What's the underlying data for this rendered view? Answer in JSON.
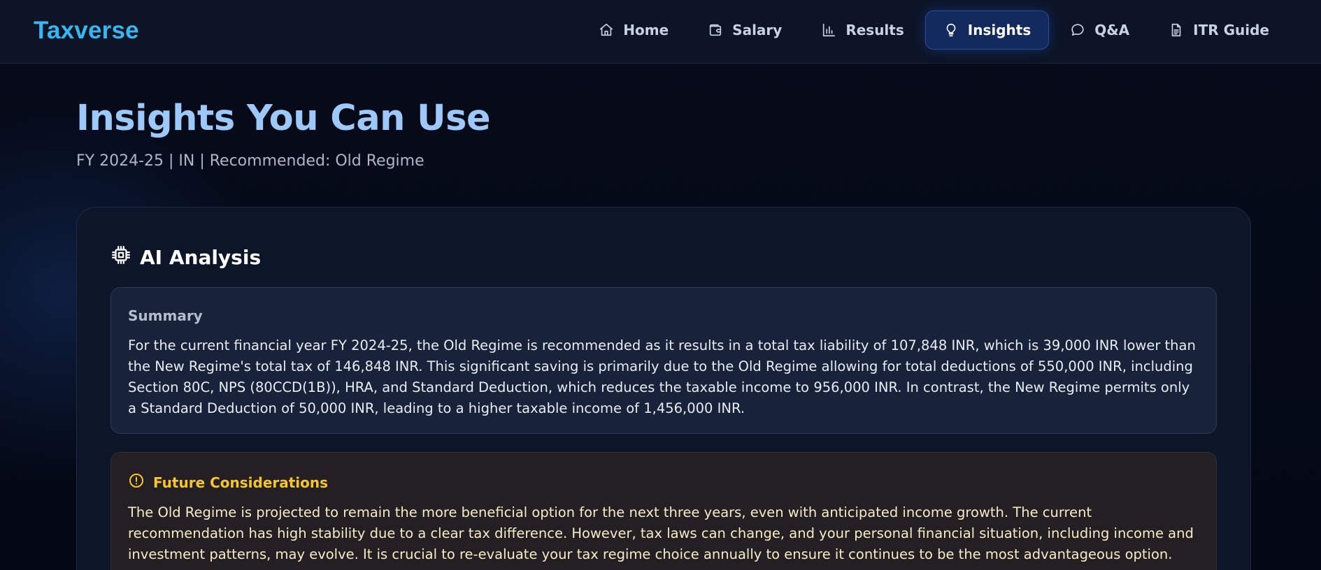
{
  "brand": "Taxverse",
  "nav": {
    "items": [
      {
        "label": "Home",
        "icon": "home-icon"
      },
      {
        "label": "Salary",
        "icon": "wallet-icon"
      },
      {
        "label": "Results",
        "icon": "bar-chart-icon"
      },
      {
        "label": "Insights",
        "icon": "lightbulb-icon",
        "active": true
      },
      {
        "label": "Q&A",
        "icon": "chat-bubble-icon"
      },
      {
        "label": "ITR Guide",
        "icon": "document-icon"
      }
    ]
  },
  "header": {
    "title": "Insights You Can Use",
    "subtitle": "FY 2024-25 | IN | Recommended: Old Regime"
  },
  "analysis": {
    "heading": "AI Analysis",
    "heading_icon": "cpu-chip-icon",
    "summary": {
      "title": "Summary",
      "text": "For the current financial year FY 2024-25, the Old Regime is recommended as it results in a total tax liability of 107,848 INR, which is 39,000 INR lower than the New Regime's total tax of 146,848 INR. This significant saving is primarily due to the Old Regime allowing for total deductions of 550,000 INR, including Section 80C, NPS (80CCD(1B)), HRA, and Standard Deduction, which reduces the taxable income to 956,000 INR. In contrast, the New Regime permits only a Standard Deduction of 50,000 INR, leading to a higher taxable income of 1,456,000 INR."
    },
    "future": {
      "title": "Future Considerations",
      "icon": "alert-circle-icon",
      "text": "The Old Regime is projected to remain the more beneficial option for the next three years, even with anticipated income growth. The current recommendation has high stability due to a clear tax difference. However, tax laws can change, and your personal financial situation, including income and investment patterns, may evolve. It is crucial to re-evaluate your tax regime choice annually to ensure it continues to be the most advantageous option."
    }
  },
  "colors": {
    "brand": "#38b6f0",
    "title": "#9ec8f8",
    "active_nav": "#132a5e",
    "warning": "#f6c62c"
  }
}
